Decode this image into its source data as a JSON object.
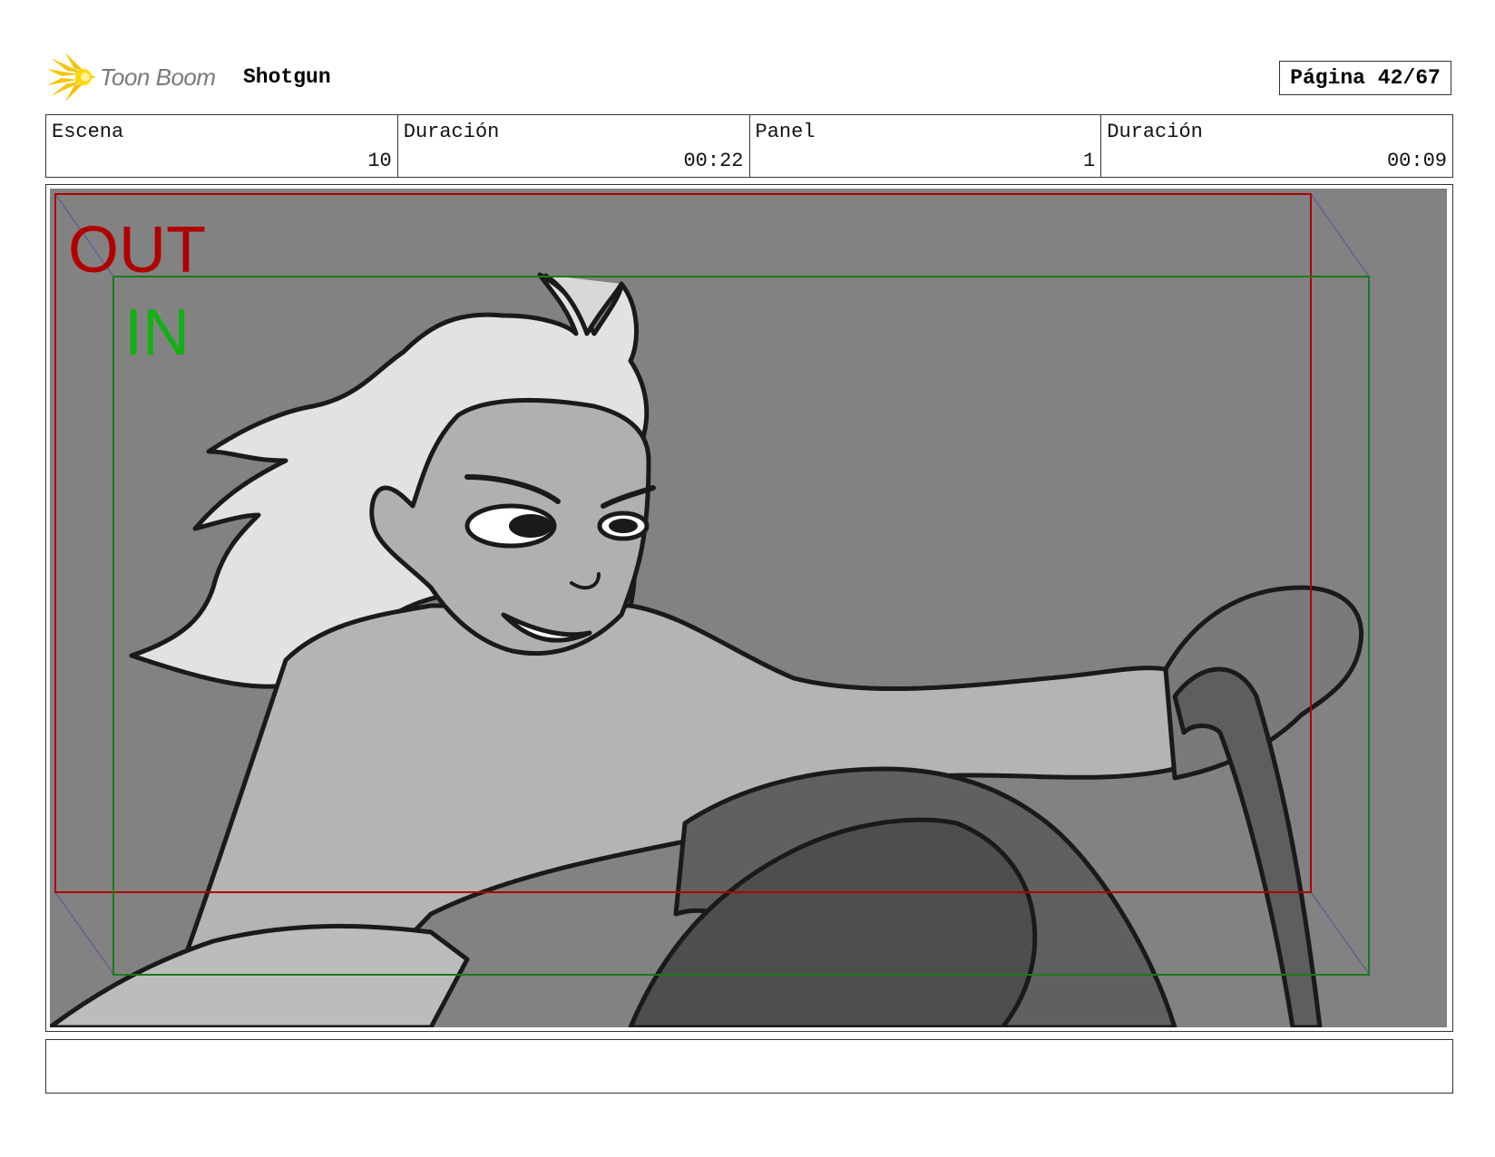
{
  "header": {
    "logo_text": "Toon Boom",
    "project": "Shotgun",
    "page": "Página 42/67"
  },
  "info": {
    "scene_label": "Escena",
    "scene_value": "10",
    "scene_duration_label": "Duración",
    "scene_duration_value": "00:22",
    "panel_label": "Panel",
    "panel_value": "1",
    "panel_duration_label": "Duración",
    "panel_duration_value": "00:09"
  },
  "frame_labels": {
    "out": "OUT",
    "in": "IN"
  },
  "colors": {
    "out_frame": "#b00000",
    "in_frame": "#1a8a1a",
    "in_text": "#12b012",
    "background_gray": "#828282",
    "logo_accent": "#f5c400"
  },
  "notes": ""
}
